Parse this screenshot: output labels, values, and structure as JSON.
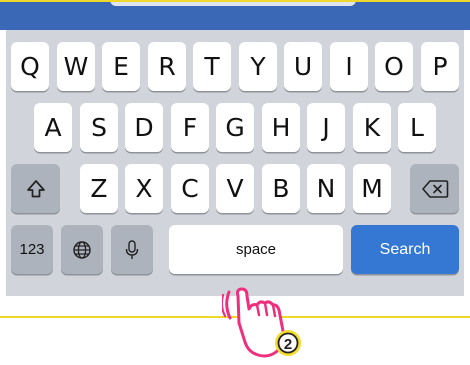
{
  "keyboard": {
    "row1": [
      "Q",
      "W",
      "E",
      "R",
      "T",
      "Y",
      "U",
      "I",
      "O",
      "P"
    ],
    "row2": [
      "A",
      "S",
      "D",
      "F",
      "G",
      "H",
      "J",
      "K",
      "L"
    ],
    "row3": [
      "Z",
      "X",
      "C",
      "V",
      "B",
      "N",
      "M"
    ],
    "numbers_label": "123",
    "space_label": "space",
    "search_label": "Search"
  },
  "icons": {
    "shift": "shift-icon",
    "backspace": "backspace-icon",
    "globe": "globe-icon",
    "mic": "microphone-icon",
    "hand": "tap-hand-icon"
  },
  "annotation": {
    "step_number": "2"
  },
  "colors": {
    "accent": "#3478d4",
    "header": "#3a68b6",
    "highlight_line": "#f0d72b",
    "hand": "#ed2f7e",
    "badge": "#f3dc2e"
  }
}
